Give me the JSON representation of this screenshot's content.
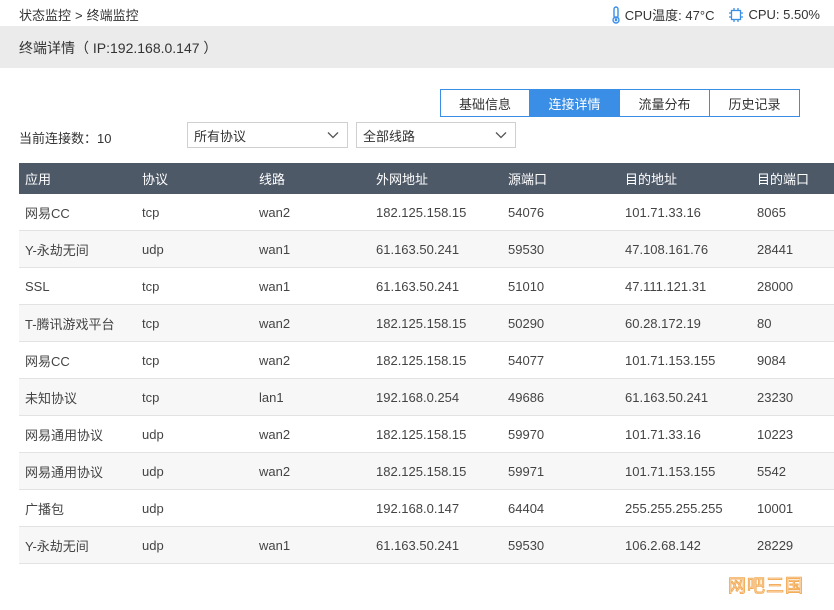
{
  "breadcrumb": {
    "parent": "状态监控",
    "separator": ">",
    "current": "终端监控"
  },
  "status": {
    "temp_label": "CPU温度: 47°C",
    "cpu_label": "CPU: 5.50%"
  },
  "page_title": "终端详情（ IP:192.168.0.147 ）",
  "tabs": [
    {
      "label": "基础信息",
      "active": false
    },
    {
      "label": "连接详情",
      "active": true
    },
    {
      "label": "流量分布",
      "active": false
    },
    {
      "label": "历史记录",
      "active": false
    }
  ],
  "filters": {
    "conn_label": "当前连接数：10",
    "protocol_select": "所有协议",
    "line_select": "全部线路"
  },
  "table": {
    "headers": [
      "应用",
      "协议",
      "线路",
      "外网地址",
      "源端口",
      "目的地址",
      "目的端口"
    ],
    "rows": [
      [
        "网易CC",
        "tcp",
        "wan2",
        "182.125.158.15",
        "54076",
        "101.71.33.16",
        "8065"
      ],
      [
        "Y-永劫无间",
        "udp",
        "wan1",
        "61.163.50.241",
        "59530",
        "47.108.161.76",
        "28441"
      ],
      [
        "SSL",
        "tcp",
        "wan1",
        "61.163.50.241",
        "51010",
        "47.111.121.31",
        "28000"
      ],
      [
        "T-腾讯游戏平台",
        "tcp",
        "wan2",
        "182.125.158.15",
        "50290",
        "60.28.172.19",
        "80"
      ],
      [
        "网易CC",
        "tcp",
        "wan2",
        "182.125.158.15",
        "54077",
        "101.71.153.155",
        "9084"
      ],
      [
        "未知协议",
        "tcp",
        "lan1",
        "192.168.0.254",
        "49686",
        "61.163.50.241",
        "23230"
      ],
      [
        "网易通用协议",
        "udp",
        "wan2",
        "182.125.158.15",
        "59970",
        "101.71.33.16",
        "10223"
      ],
      [
        "网易通用协议",
        "udp",
        "wan2",
        "182.125.158.15",
        "59971",
        "101.71.153.155",
        "5542"
      ],
      [
        "广播包",
        "udp",
        "",
        "192.168.0.147",
        "64404",
        "255.255.255.255",
        "10001"
      ],
      [
        "Y-永劫无间",
        "udp",
        "wan1",
        "61.163.50.241",
        "59530",
        "106.2.68.142",
        "28229"
      ]
    ]
  },
  "watermark": "网吧三国",
  "colors": {
    "accent": "#3a8ee6",
    "header_bg": "#4e5968",
    "title_bg": "#ebebeb"
  },
  "icons": {
    "temp": "thermometer-icon",
    "cpu": "chip-icon",
    "dropdown": "chevron-down-icon"
  }
}
